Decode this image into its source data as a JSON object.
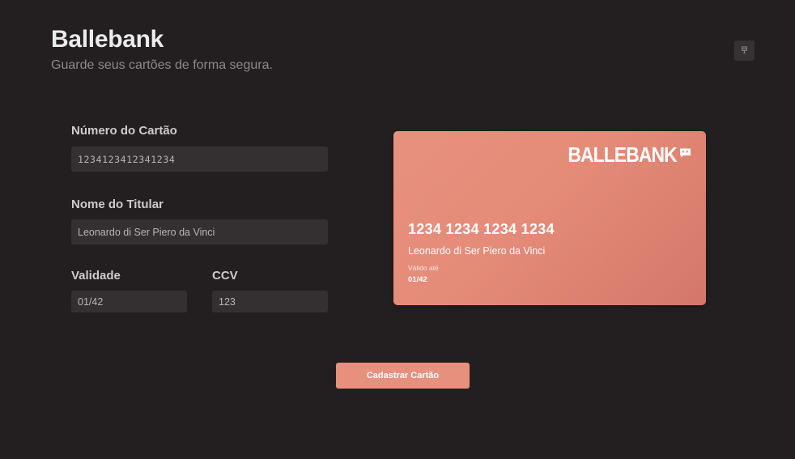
{
  "header": {
    "title": "Ballebank",
    "subtitle": "Guarde seus cartões de forma segura."
  },
  "theme_toggle": {
    "icon": "theme-toggle-icon"
  },
  "form": {
    "card_number": {
      "label": "Número do Cartão",
      "value": "1234123412341234"
    },
    "holder_name": {
      "label": "Nome do Titular",
      "value": "Leonardo di Ser Piero da Vinci"
    },
    "expiry": {
      "label": "Validade",
      "value": "01/42"
    },
    "ccv": {
      "label": "CCV",
      "value": "123"
    },
    "submit_label": "Cadastrar Cartão"
  },
  "card_preview": {
    "brand": "BALLEBANK",
    "brand_icon": "chip-icon",
    "number": "1234 1234 1234 1234",
    "holder": "Leonardo di Ser Piero da Vinci",
    "valid_label": "Válido até",
    "valid_value": "01/42"
  },
  "colors": {
    "background": "#231f20",
    "accent": "#e8907e",
    "input_bg": "#343031"
  }
}
